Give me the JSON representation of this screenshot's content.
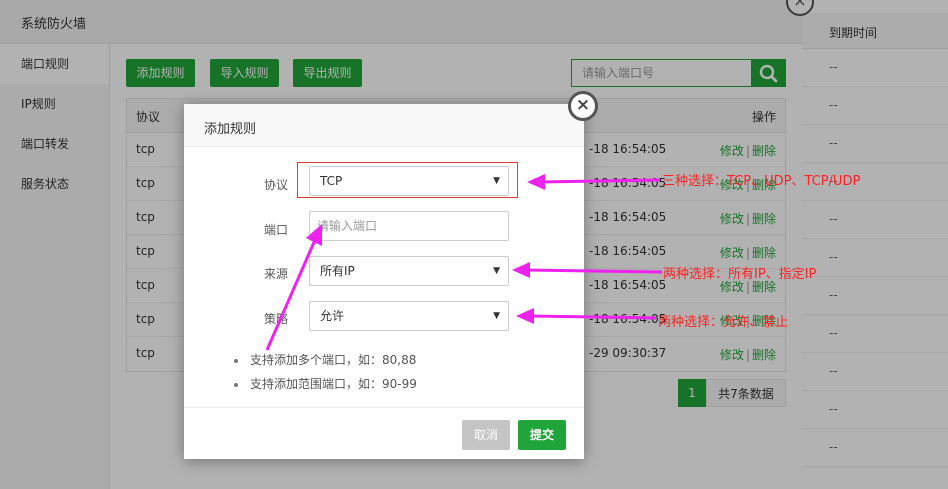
{
  "window": {
    "title": "系统防火墙"
  },
  "sidebar": {
    "items": [
      {
        "label": "端口规则"
      },
      {
        "label": "IP规则"
      },
      {
        "label": "端口转发"
      },
      {
        "label": "服务状态"
      }
    ]
  },
  "toolbar": {
    "add_label": "添加规则",
    "import_label": "导入规则",
    "export_label": "导出规则",
    "search_placeholder": "请输入端口号"
  },
  "table": {
    "headers": {
      "protocol": "协议",
      "action": "操作"
    },
    "edit_label": "修改",
    "sep": "|",
    "delete_label": "删除",
    "rows": [
      {
        "protocol": "tcp",
        "time": "-18 16:54:05"
      },
      {
        "protocol": "tcp",
        "time": "-18 16:54:05"
      },
      {
        "protocol": "tcp",
        "time": "-18 16:54:05"
      },
      {
        "protocol": "tcp",
        "time": "-18 16:54:05"
      },
      {
        "protocol": "tcp",
        "time": "-18 16:54:05"
      },
      {
        "protocol": "tcp",
        "time": "-18 16:54:05"
      },
      {
        "protocol": "tcp",
        "time": "-29 09:30:37"
      }
    ]
  },
  "pager": {
    "current": "1",
    "total_label": "共7条数据"
  },
  "background_table": {
    "expire_header": "到期时间",
    "cells": [
      "--",
      "--",
      "--",
      "--",
      "--",
      "--",
      "--",
      "--",
      "--",
      "--",
      "--"
    ]
  },
  "modal": {
    "title": "添加规则",
    "close_glyph": "×",
    "protocol_label": "协议",
    "protocol_value": "TCP",
    "port_label": "端口",
    "port_placeholder": "请输入端口",
    "source_label": "来源",
    "source_value": "所有IP",
    "policy_label": "策略",
    "policy_value": "允许",
    "arrow_glyph": "▼",
    "tips": [
      "支持添加多个端口，如：80,88",
      "支持添加范围端口，如：90-99"
    ],
    "cancel_label": "取消",
    "submit_label": "提交"
  },
  "annotations": {
    "protocol_note": "三种选择：TCP、UDP、TCP/UDP",
    "source_note": "两种选择：所有IP、指定IP",
    "policy_note": "两种选择：允许、禁止"
  },
  "colors": {
    "accent": "#20a53a",
    "annotation": "#ff2222",
    "arrow": "#ee22ee"
  }
}
